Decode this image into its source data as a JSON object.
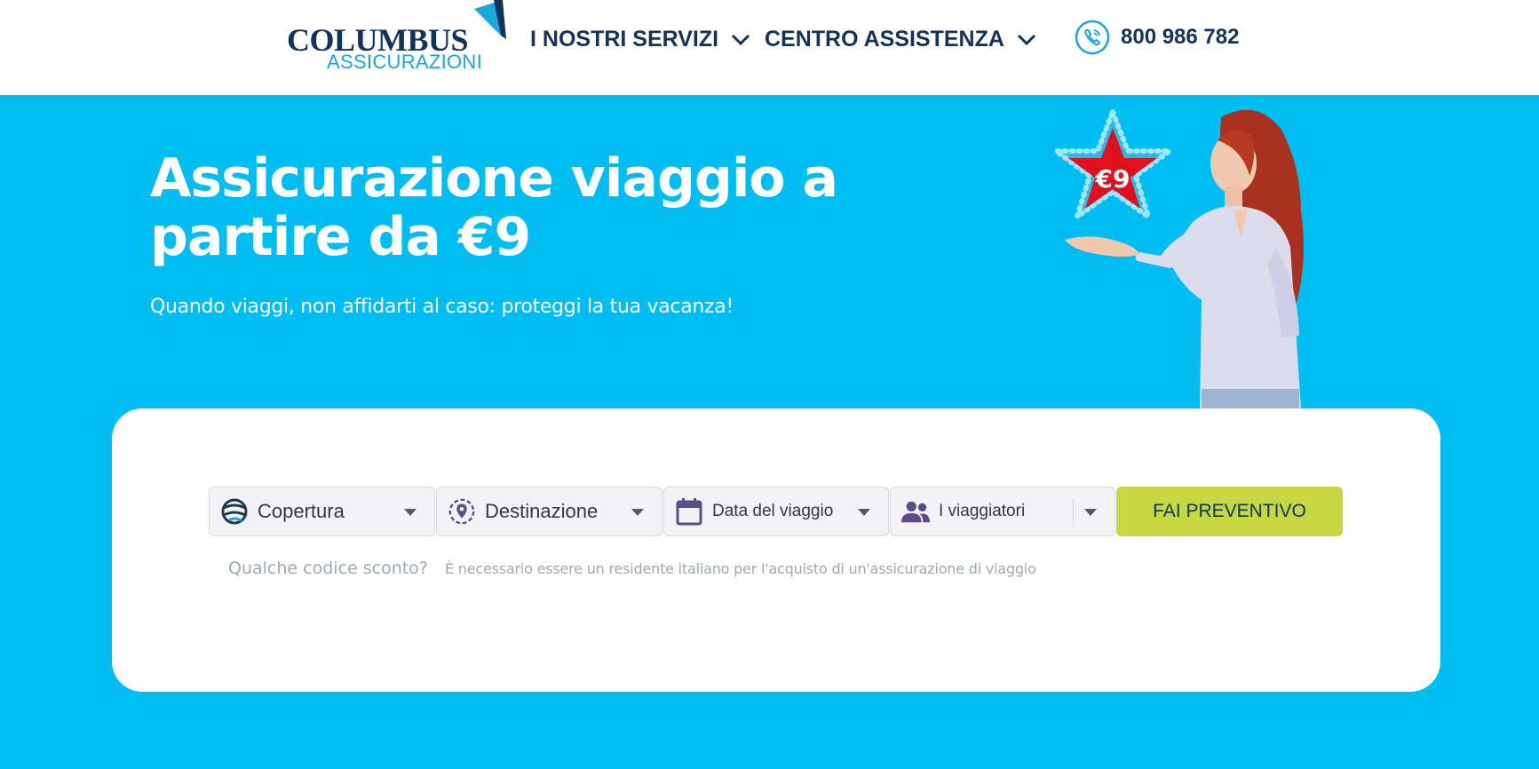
{
  "header": {
    "logo": {
      "name": "COLUMBUS",
      "tagline": "ASSICURAZIONI"
    },
    "nav": [
      {
        "label": "I NOSTRI SERVIZI",
        "icon": "chevron-down-icon"
      },
      {
        "label": "CENTRO ASSISTENZA",
        "icon": "chevron-down-icon"
      }
    ],
    "phone": {
      "icon": "phone-icon",
      "number": "800 986 782"
    }
  },
  "hero": {
    "title": "Assicurazione viaggio a partire da €9",
    "subtitle": "Quando viaggi, non affidarti al caso: proteggi la tua vacanza!",
    "badge": "€9"
  },
  "form": {
    "fields": [
      {
        "label": "Copertura",
        "icon": "globe-icon"
      },
      {
        "label": "Destinazione",
        "icon": "location-pin-icon"
      },
      {
        "label": "Data del viaggio",
        "icon": "calendar-icon"
      },
      {
        "label": "I viaggiatori",
        "icon": "people-icon"
      }
    ],
    "submit": "FAI PREVENTIVO",
    "discount_link": "Qualche codice sconto?",
    "notice": "È necessario essere un residente italiano per l'acquisto di un'assicurazione di viaggio"
  },
  "colors": {
    "brand_navy": "#13335a",
    "brand_blue": "#1aa7de",
    "hero_bg": "#00bdf2",
    "cta": "#c5d841",
    "badge_star": "#e0101e"
  }
}
